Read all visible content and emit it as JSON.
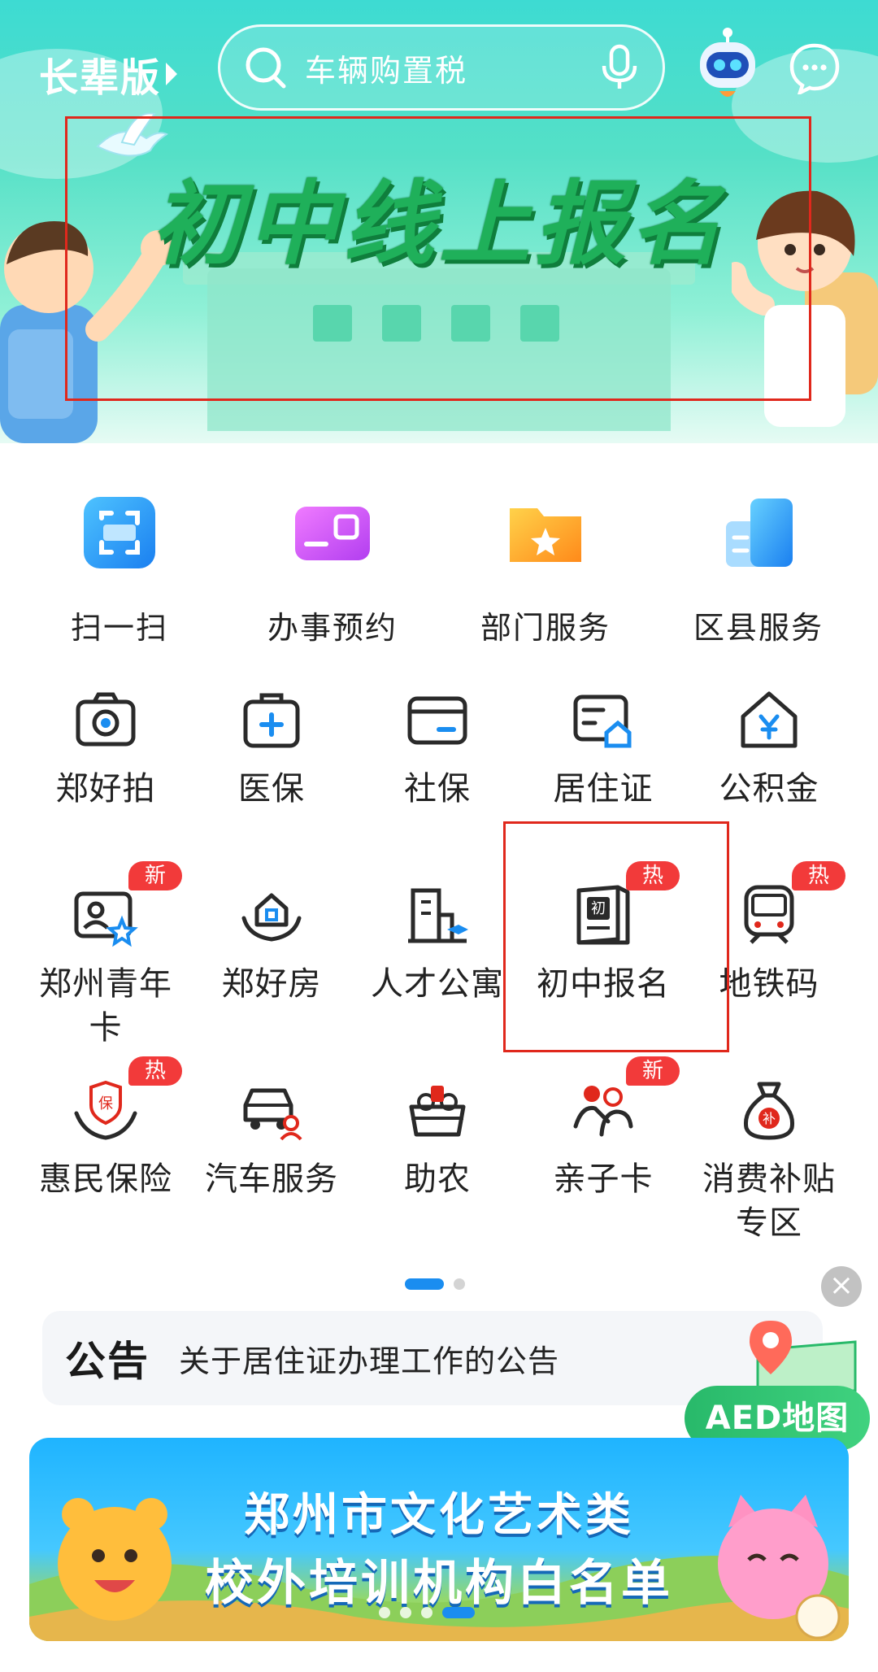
{
  "header": {
    "elder_mode_label": "长辈版",
    "search_placeholder": "车辆购置税"
  },
  "hero_banner": {
    "title": "初中线上报名"
  },
  "quick_services": [
    {
      "label": "扫一扫",
      "icon": "scan-icon",
      "color": "#2c8ff0"
    },
    {
      "label": "办事预约",
      "icon": "appointment-card-icon",
      "color": "#c24ff0"
    },
    {
      "label": "部门服务",
      "icon": "folder-star-icon",
      "color": "#ffa21a"
    },
    {
      "label": "区县服务",
      "icon": "buildings-icon",
      "color": "#2c8ff0"
    }
  ],
  "services_grid": [
    {
      "label": "郑好拍",
      "icon": "camera-icon",
      "badge": ""
    },
    {
      "label": "医保",
      "icon": "medical-kit-icon",
      "badge": ""
    },
    {
      "label": "社保",
      "icon": "card-icon",
      "badge": ""
    },
    {
      "label": "居住证",
      "icon": "residence-permit-icon",
      "badge": ""
    },
    {
      "label": "公积金",
      "icon": "housing-fund-icon",
      "badge": ""
    },
    {
      "label": "郑州青年卡",
      "icon": "youth-card-icon",
      "badge": "新"
    },
    {
      "label": "郑好房",
      "icon": "house-hands-icon",
      "badge": ""
    },
    {
      "label": "人才公寓",
      "icon": "talent-apartment-icon",
      "badge": ""
    },
    {
      "label": "初中报名",
      "icon": "book-enroll-icon",
      "badge": "热"
    },
    {
      "label": "地铁码",
      "icon": "metro-icon",
      "badge": "热"
    },
    {
      "label": "惠民保险",
      "icon": "insurance-hands-icon",
      "badge": "热"
    },
    {
      "label": "汽车服务",
      "icon": "car-service-icon",
      "badge": ""
    },
    {
      "label": "助农",
      "icon": "farm-basket-icon",
      "badge": ""
    },
    {
      "label": "亲子卡",
      "icon": "parent-child-icon",
      "badge": "新"
    },
    {
      "label": "消费补贴专区",
      "icon": "subsidy-bag-icon",
      "badge": ""
    }
  ],
  "notice": {
    "tag": "公告",
    "text": "关于居住证办理工作的公告"
  },
  "aed_button": {
    "label": "AED地图"
  },
  "promo_banner": {
    "line1": "郑州市文化艺术类",
    "line2": "校外培训机构白名单"
  },
  "colors": {
    "accent": "#1a8df0",
    "badge": "#f23a3a",
    "highlight_frame": "#e0281c",
    "hero_title": "#1fb05a"
  }
}
